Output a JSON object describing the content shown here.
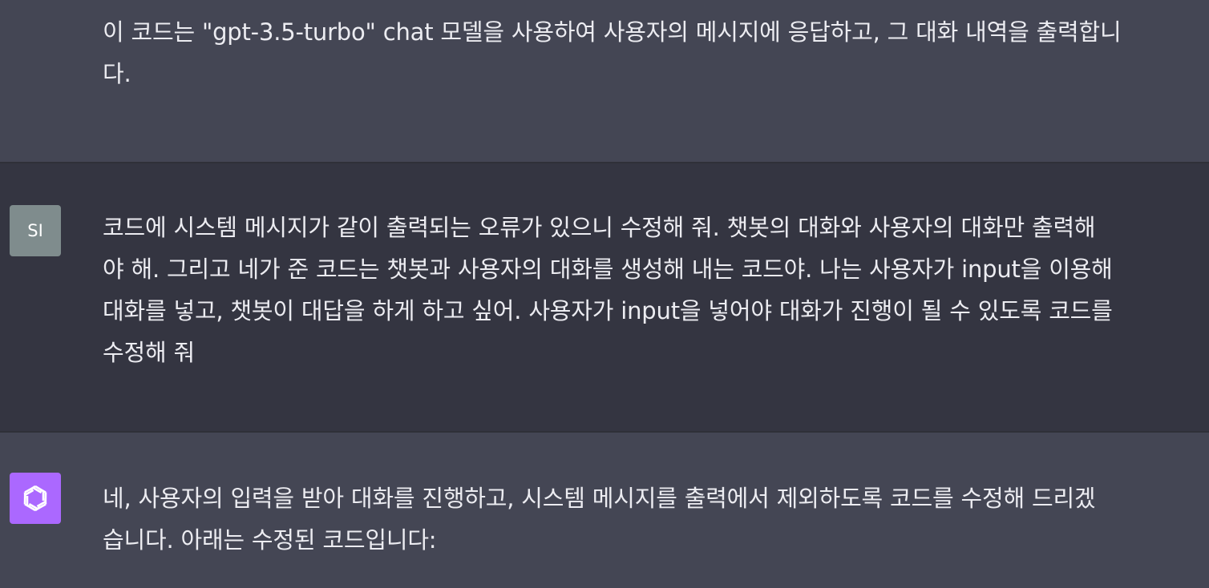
{
  "colors": {
    "assistant_bg": "#444654",
    "user_bg": "#343541",
    "text": "#ececf1",
    "user_avatar_bg": "#7f8c8d",
    "assistant_avatar_bg": "#ab68ff"
  },
  "messages": [
    {
      "role": "assistant",
      "avatar_icon": "openai-logo-icon",
      "lines": [
        "이 코드는 \"gpt-3.5-turbo\" chat 모델을 사용하여 사용자의 메시지에 응답하고, 그 대화 내역을 출력합니",
        "다."
      ]
    },
    {
      "role": "user",
      "avatar_text": "SI",
      "lines": [
        "코드에 시스템 메시지가 같이 출력되는 오류가 있으니 수정해 줘. 챗봇의 대화와 사용자의 대화만 출력해",
        "야 해. 그리고 네가 준 코드는 챗봇과 사용자의 대화를 생성해 내는 코드야. 나는 사용자가 input을 이용해",
        "대화를 넣고, 챗봇이 대답을 하게 하고 싶어. 사용자가 input을 넣어야 대화가 진행이 될 수 있도록 코드를",
        "수정해 줘"
      ]
    },
    {
      "role": "assistant",
      "avatar_icon": "openai-logo-icon",
      "lines": [
        "네, 사용자의 입력을 받아 대화를 진행하고, 시스템 메시지를 출력에서 제외하도록 코드를 수정해 드리겠",
        "습니다. 아래는 수정된 코드입니다:"
      ]
    }
  ]
}
